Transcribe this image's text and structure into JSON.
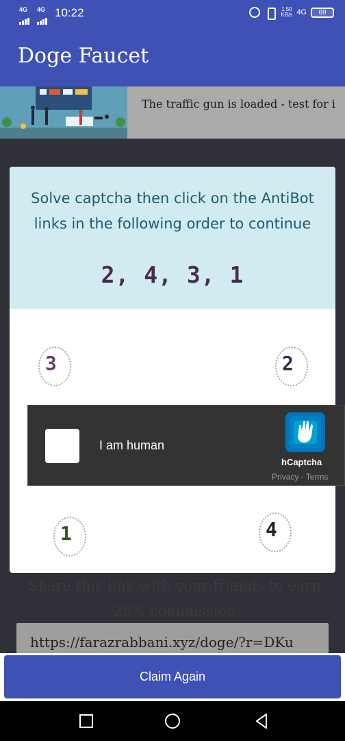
{
  "status_bar": {
    "signal_1": "4G",
    "signal_2": "4G",
    "time": "10:22",
    "net_speed_value": "1.50",
    "net_speed_unit": "KB/s",
    "network": "4G",
    "battery": "69"
  },
  "app_bar": {
    "title": "Doge Faucet"
  },
  "ad_banner": {
    "text": "The traffic gun is loaded - test for i"
  },
  "modal": {
    "message": "Solve captcha then click on the AntiBot links in the following order to continue",
    "order": "2, 4, 3, 1",
    "antibot_links": [
      {
        "label": "3",
        "color": "#6b3a6f"
      },
      {
        "label": "2",
        "color": "#3b2a4a"
      },
      {
        "label": "1",
        "color": "#2e5b1e"
      },
      {
        "label": "4",
        "color": "#222222"
      }
    ]
  },
  "hcaptcha": {
    "checkbox_label": "I am human",
    "brand": "hCaptcha",
    "legal": "Privacy - Terms"
  },
  "referral": {
    "share_text": "Share this link with your friends to earn 25% commission",
    "link": "https://farazrabbani.xyz/doge/?r=DKu"
  },
  "claim_button": {
    "label": "Claim Again"
  },
  "nav_bar": {
    "icons": [
      "recents-icon",
      "home-icon",
      "back-icon"
    ]
  },
  "colors": {
    "primary": "#3f51b5",
    "modal_header": "#d2ebf1",
    "modal_text": "#1d5a6e",
    "captcha_bg": "#333333"
  }
}
